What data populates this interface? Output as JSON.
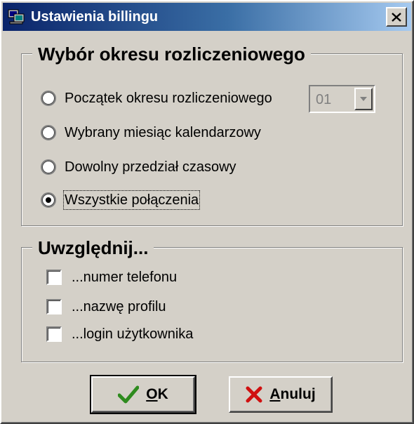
{
  "window": {
    "title": "Ustawienia billingu",
    "close_symbol": "✕"
  },
  "period_group": {
    "title": "Wybór okresu rozliczeniowego",
    "options": [
      {
        "label": "Początek okresu rozliczeniowego",
        "selected": false
      },
      {
        "label": "Wybrany miesiąc kalendarzowy",
        "selected": false
      },
      {
        "label": "Dowolny przedział czasowy",
        "selected": false
      },
      {
        "label": "Wszystkie połączenia",
        "selected": true
      }
    ],
    "day_select": {
      "value": "01",
      "enabled": false
    }
  },
  "include_group": {
    "title": "Uwzględnij...",
    "options": [
      {
        "label": "...numer telefonu",
        "checked": false
      },
      {
        "label": "...nazwę profilu",
        "checked": false
      },
      {
        "label": "...login użytkownika",
        "checked": false
      }
    ]
  },
  "buttons": {
    "ok_label": "OK",
    "cancel_label": "Anuluj"
  },
  "colors": {
    "face": "#d4d0c8",
    "title_gradient_start": "#0a246a",
    "title_gradient_end": "#a6caf0",
    "ok_icon": "#2e8b1e",
    "cancel_icon": "#d01010"
  },
  "icons": {
    "app": "computer-icon",
    "close": "close-icon",
    "ok": "checkmark-icon",
    "cancel": "x-icon",
    "dropdown": "dropdown-arrow-icon"
  }
}
